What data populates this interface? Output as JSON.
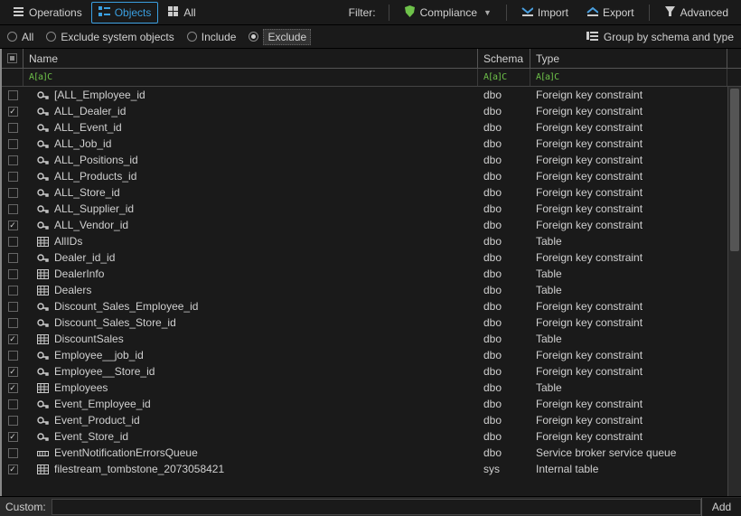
{
  "toolbar": {
    "operations": "Operations",
    "objects": "Objects",
    "all": "All",
    "filter_label": "Filter:",
    "compliance": "Compliance",
    "import": "Import",
    "export": "Export",
    "advanced": "Advanced"
  },
  "filters": {
    "all": "All",
    "exclude_system": "Exclude system objects",
    "include": "Include",
    "exclude": "Exclude",
    "group_by": "Group by schema and type"
  },
  "columns": {
    "name": "Name",
    "schema": "Schema",
    "type": "Type"
  },
  "filter_token": "A[a]C",
  "rows": [
    {
      "checked": false,
      "icon": "key",
      "name": "[ALL_Employee_id",
      "schema": "dbo",
      "type": "Foreign key constraint"
    },
    {
      "checked": true,
      "icon": "key",
      "name": "ALL_Dealer_id",
      "schema": "dbo",
      "type": "Foreign key constraint"
    },
    {
      "checked": false,
      "icon": "key",
      "name": "ALL_Event_id",
      "schema": "dbo",
      "type": "Foreign key constraint"
    },
    {
      "checked": false,
      "icon": "key",
      "name": "ALL_Job_id",
      "schema": "dbo",
      "type": "Foreign key constraint"
    },
    {
      "checked": false,
      "icon": "key",
      "name": "ALL_Positions_id",
      "schema": "dbo",
      "type": "Foreign key constraint"
    },
    {
      "checked": false,
      "icon": "key",
      "name": "ALL_Products_id",
      "schema": "dbo",
      "type": "Foreign key constraint"
    },
    {
      "checked": false,
      "icon": "key",
      "name": "ALL_Store_id",
      "schema": "dbo",
      "type": "Foreign key constraint"
    },
    {
      "checked": false,
      "icon": "key",
      "name": "ALL_Supplier_id",
      "schema": "dbo",
      "type": "Foreign key constraint"
    },
    {
      "checked": true,
      "icon": "key",
      "name": "ALL_Vendor_id",
      "schema": "dbo",
      "type": "Foreign key constraint"
    },
    {
      "checked": false,
      "icon": "table",
      "name": "AllIDs",
      "schema": "dbo",
      "type": "Table"
    },
    {
      "checked": false,
      "icon": "key",
      "name": "Dealer_id_id",
      "schema": "dbo",
      "type": "Foreign key constraint"
    },
    {
      "checked": false,
      "icon": "table",
      "name": "DealerInfo",
      "schema": "dbo",
      "type": "Table"
    },
    {
      "checked": false,
      "icon": "table",
      "name": "Dealers",
      "schema": "dbo",
      "type": "Table"
    },
    {
      "checked": false,
      "icon": "key",
      "name": "Discount_Sales_Employee_id",
      "schema": "dbo",
      "type": "Foreign key constraint"
    },
    {
      "checked": false,
      "icon": "key",
      "name": "Discount_Sales_Store_id",
      "schema": "dbo",
      "type": "Foreign key constraint"
    },
    {
      "checked": true,
      "icon": "table",
      "name": "DiscountSales",
      "schema": "dbo",
      "type": "Table"
    },
    {
      "checked": false,
      "icon": "key",
      "name": "Employee__job_id",
      "schema": "dbo",
      "type": "Foreign key constraint"
    },
    {
      "checked": true,
      "icon": "key",
      "name": "Employee__Store_id",
      "schema": "dbo",
      "type": "Foreign key constraint"
    },
    {
      "checked": true,
      "icon": "table",
      "name": "Employees",
      "schema": "dbo",
      "type": "Table"
    },
    {
      "checked": false,
      "icon": "key",
      "name": "Event_Employee_id",
      "schema": "dbo",
      "type": "Foreign key constraint"
    },
    {
      "checked": false,
      "icon": "key",
      "name": "Event_Product_id",
      "schema": "dbo",
      "type": "Foreign key constraint"
    },
    {
      "checked": true,
      "icon": "key",
      "name": "Event_Store_id",
      "schema": "dbo",
      "type": "Foreign key constraint"
    },
    {
      "checked": false,
      "icon": "queue",
      "name": "EventNotificationErrorsQueue",
      "schema": "dbo",
      "type": "Service broker service queue"
    },
    {
      "checked": true,
      "icon": "table",
      "name": "filestream_tombstone_2073058421",
      "schema": "sys",
      "type": "Internal table"
    }
  ],
  "footer": {
    "custom": "Custom:",
    "add": "Add"
  }
}
